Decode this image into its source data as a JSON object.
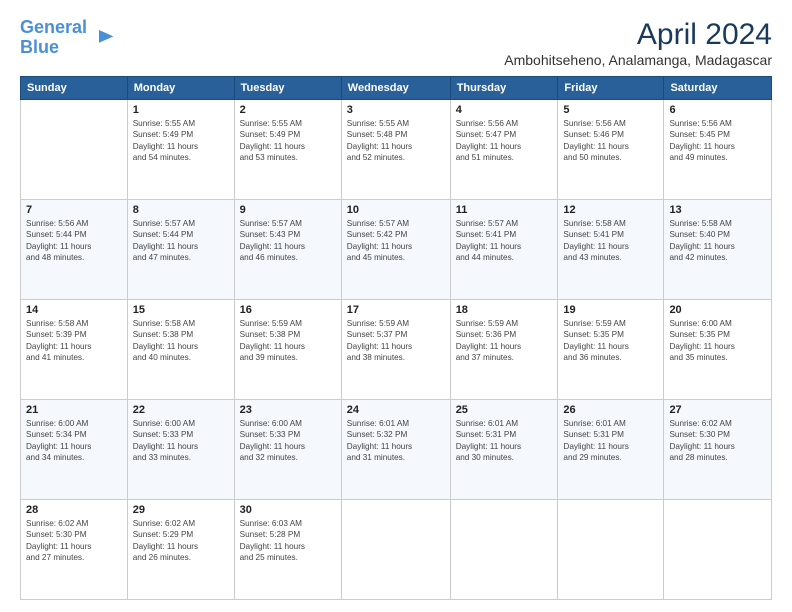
{
  "header": {
    "logo_line1": "General",
    "logo_line2": "Blue",
    "month_year": "April 2024",
    "location": "Ambohitseheno, Analamanga, Madagascar"
  },
  "weekdays": [
    "Sunday",
    "Monday",
    "Tuesday",
    "Wednesday",
    "Thursday",
    "Friday",
    "Saturday"
  ],
  "weeks": [
    [
      {
        "day": "",
        "info": ""
      },
      {
        "day": "1",
        "info": "Sunrise: 5:55 AM\nSunset: 5:49 PM\nDaylight: 11 hours\nand 54 minutes."
      },
      {
        "day": "2",
        "info": "Sunrise: 5:55 AM\nSunset: 5:49 PM\nDaylight: 11 hours\nand 53 minutes."
      },
      {
        "day": "3",
        "info": "Sunrise: 5:55 AM\nSunset: 5:48 PM\nDaylight: 11 hours\nand 52 minutes."
      },
      {
        "day": "4",
        "info": "Sunrise: 5:56 AM\nSunset: 5:47 PM\nDaylight: 11 hours\nand 51 minutes."
      },
      {
        "day": "5",
        "info": "Sunrise: 5:56 AM\nSunset: 5:46 PM\nDaylight: 11 hours\nand 50 minutes."
      },
      {
        "day": "6",
        "info": "Sunrise: 5:56 AM\nSunset: 5:45 PM\nDaylight: 11 hours\nand 49 minutes."
      }
    ],
    [
      {
        "day": "7",
        "info": "Sunrise: 5:56 AM\nSunset: 5:44 PM\nDaylight: 11 hours\nand 48 minutes."
      },
      {
        "day": "8",
        "info": "Sunrise: 5:57 AM\nSunset: 5:44 PM\nDaylight: 11 hours\nand 47 minutes."
      },
      {
        "day": "9",
        "info": "Sunrise: 5:57 AM\nSunset: 5:43 PM\nDaylight: 11 hours\nand 46 minutes."
      },
      {
        "day": "10",
        "info": "Sunrise: 5:57 AM\nSunset: 5:42 PM\nDaylight: 11 hours\nand 45 minutes."
      },
      {
        "day": "11",
        "info": "Sunrise: 5:57 AM\nSunset: 5:41 PM\nDaylight: 11 hours\nand 44 minutes."
      },
      {
        "day": "12",
        "info": "Sunrise: 5:58 AM\nSunset: 5:41 PM\nDaylight: 11 hours\nand 43 minutes."
      },
      {
        "day": "13",
        "info": "Sunrise: 5:58 AM\nSunset: 5:40 PM\nDaylight: 11 hours\nand 42 minutes."
      }
    ],
    [
      {
        "day": "14",
        "info": "Sunrise: 5:58 AM\nSunset: 5:39 PM\nDaylight: 11 hours\nand 41 minutes."
      },
      {
        "day": "15",
        "info": "Sunrise: 5:58 AM\nSunset: 5:38 PM\nDaylight: 11 hours\nand 40 minutes."
      },
      {
        "day": "16",
        "info": "Sunrise: 5:59 AM\nSunset: 5:38 PM\nDaylight: 11 hours\nand 39 minutes."
      },
      {
        "day": "17",
        "info": "Sunrise: 5:59 AM\nSunset: 5:37 PM\nDaylight: 11 hours\nand 38 minutes."
      },
      {
        "day": "18",
        "info": "Sunrise: 5:59 AM\nSunset: 5:36 PM\nDaylight: 11 hours\nand 37 minutes."
      },
      {
        "day": "19",
        "info": "Sunrise: 5:59 AM\nSunset: 5:35 PM\nDaylight: 11 hours\nand 36 minutes."
      },
      {
        "day": "20",
        "info": "Sunrise: 6:00 AM\nSunset: 5:35 PM\nDaylight: 11 hours\nand 35 minutes."
      }
    ],
    [
      {
        "day": "21",
        "info": "Sunrise: 6:00 AM\nSunset: 5:34 PM\nDaylight: 11 hours\nand 34 minutes."
      },
      {
        "day": "22",
        "info": "Sunrise: 6:00 AM\nSunset: 5:33 PM\nDaylight: 11 hours\nand 33 minutes."
      },
      {
        "day": "23",
        "info": "Sunrise: 6:00 AM\nSunset: 5:33 PM\nDaylight: 11 hours\nand 32 minutes."
      },
      {
        "day": "24",
        "info": "Sunrise: 6:01 AM\nSunset: 5:32 PM\nDaylight: 11 hours\nand 31 minutes."
      },
      {
        "day": "25",
        "info": "Sunrise: 6:01 AM\nSunset: 5:31 PM\nDaylight: 11 hours\nand 30 minutes."
      },
      {
        "day": "26",
        "info": "Sunrise: 6:01 AM\nSunset: 5:31 PM\nDaylight: 11 hours\nand 29 minutes."
      },
      {
        "day": "27",
        "info": "Sunrise: 6:02 AM\nSunset: 5:30 PM\nDaylight: 11 hours\nand 28 minutes."
      }
    ],
    [
      {
        "day": "28",
        "info": "Sunrise: 6:02 AM\nSunset: 5:30 PM\nDaylight: 11 hours\nand 27 minutes."
      },
      {
        "day": "29",
        "info": "Sunrise: 6:02 AM\nSunset: 5:29 PM\nDaylight: 11 hours\nand 26 minutes."
      },
      {
        "day": "30",
        "info": "Sunrise: 6:03 AM\nSunset: 5:28 PM\nDaylight: 11 hours\nand 25 minutes."
      },
      {
        "day": "",
        "info": ""
      },
      {
        "day": "",
        "info": ""
      },
      {
        "day": "",
        "info": ""
      },
      {
        "day": "",
        "info": ""
      }
    ]
  ]
}
